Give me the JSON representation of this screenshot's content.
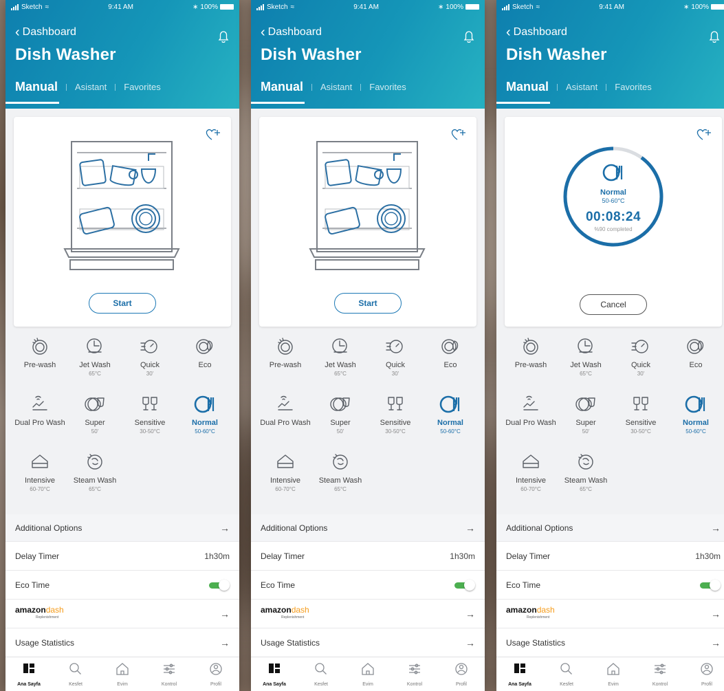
{
  "status_bar": {
    "carrier": "Sketch",
    "time": "9:41 AM",
    "battery": "100%"
  },
  "header": {
    "back_label": "Dashboard",
    "title": "Dish Washer",
    "tabs": [
      "Manual",
      "Asistant",
      "Favorites"
    ]
  },
  "card": {
    "start_label": "Start",
    "cancel_label": "Cancel",
    "running": {
      "program": "Normal",
      "temp": "50-60°C",
      "time": "00:08:24",
      "completed": "%90 completed",
      "progress": 0.9
    }
  },
  "programs": [
    {
      "name": "Pre-wash",
      "sub": "",
      "icon": "prewash-icon"
    },
    {
      "name": "Jet Wash",
      "sub": "65°C",
      "icon": "jet-wash-icon"
    },
    {
      "name": "Quick",
      "sub": "30'",
      "icon": "quick-icon"
    },
    {
      "name": "Eco",
      "sub": "",
      "icon": "eco-icon"
    },
    {
      "name": "Dual Pro Wash",
      "sub": "",
      "icon": "dual-pro-wash-icon"
    },
    {
      "name": "Super",
      "sub": "50'",
      "icon": "super-icon"
    },
    {
      "name": "Sensitive",
      "sub": "30-50°C",
      "icon": "sensitive-icon"
    },
    {
      "name": "Normal",
      "sub": "50-60°C",
      "icon": "normal-icon",
      "active": true
    },
    {
      "name": "Intensive",
      "sub": "60-70°C",
      "icon": "intensive-icon"
    },
    {
      "name": "Steam Wash",
      "sub": "65°C",
      "icon": "steam-wash-icon"
    }
  ],
  "options": {
    "additional": "Additional Options",
    "delay_label": "Delay Timer",
    "delay_value": "1h30m",
    "eco_time": "Eco Time",
    "eco_time_on": true,
    "amazon_word": "amazon",
    "amazon_dash": "dash",
    "amazon_sub": "Replenishment",
    "usage": "Usage Statistics"
  },
  "tabbar": [
    "Ana Sayfa",
    "Kesfet",
    "Evim",
    "Kontrol",
    "Profil"
  ],
  "colors": {
    "accent": "#1b6ea8",
    "header_start": "#0e7fae",
    "header_end": "#27b2c2",
    "toggle_on": "#4caf50"
  }
}
